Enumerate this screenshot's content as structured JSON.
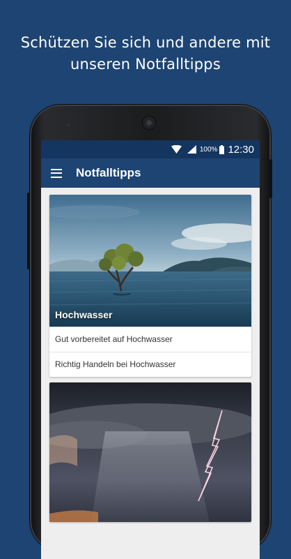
{
  "headline": {
    "line1": "Schützen Sie sich und andere mit",
    "line2": "unseren Notfalltipps"
  },
  "statusbar": {
    "battery_percent": "100%",
    "time": "12:30",
    "icons": [
      "wifi-icon",
      "signal-icon",
      "battery-icon"
    ]
  },
  "appbar": {
    "title": "Notfalltipps",
    "menu_icon": "hamburger-menu-icon"
  },
  "cards": [
    {
      "title": "Hochwasser",
      "image": "flooded-tree-lake-image",
      "items": [
        "Gut vorbereitet auf Hochwasser",
        "Richtig Handeln bei Hochwasser"
      ]
    },
    {
      "title": "",
      "image": "thunderstorm-lightning-image",
      "items": []
    }
  ],
  "colors": {
    "background": "#1d4472",
    "statusbar": "#143560",
    "appbar": "#1d4472",
    "screen_bg": "#eeeeee"
  }
}
